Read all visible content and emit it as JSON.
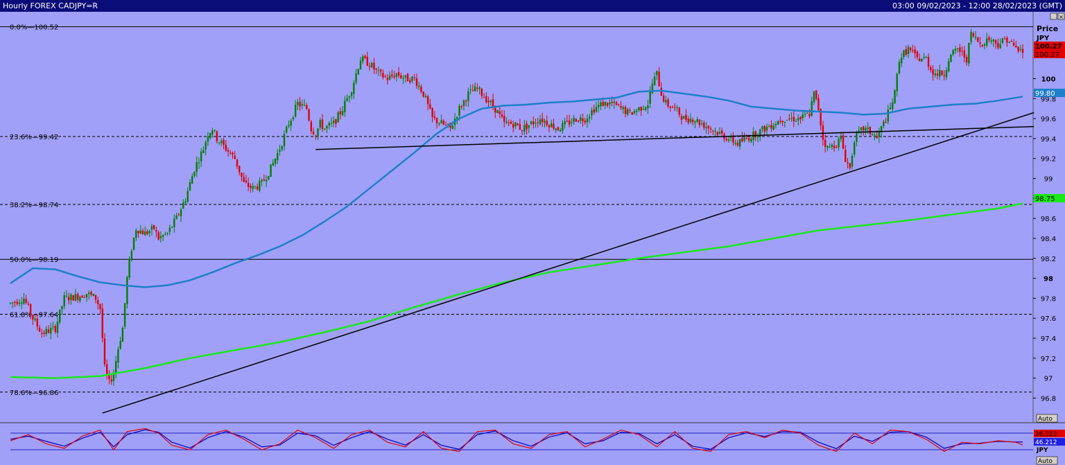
{
  "window": {
    "title": "Hourly FOREX CADJPY=R",
    "range": "03:00 09/02/2023 - 12:00 28/02/2023 (GMT)"
  },
  "axis": {
    "header": "Price",
    "unit": "JPY",
    "auto_label": "Auto",
    "lower_unit": "JPY",
    "lower_auto_label": "Auto"
  },
  "tags": {
    "last_price": "100.27",
    "last_price_2": "100.27",
    "ma_fast": "99.80",
    "ma_slow": "98.75",
    "stoch_k": "36.313",
    "stoch_d": "46.212"
  },
  "colors": {
    "background": "#a0a0f8",
    "up_candle": "#008000",
    "down_candle": "#e00000",
    "ma_fast": "#1f7fc8",
    "ma_slow": "#18e818",
    "trendline": "#000000",
    "stoch_k": "#e00000",
    "stoch_d": "#0000c0"
  },
  "chart_data": {
    "type": "line",
    "ylim": [
      96.56,
      100.67
    ],
    "y_ticks": [
      "100",
      "99.8",
      "99.6",
      "99.4",
      "99.2",
      "99",
      "98.8",
      "98.6",
      "98.4",
      "98.2",
      "98",
      "97.8",
      "97.6",
      "97.4",
      "97.2",
      "97",
      "96.8"
    ],
    "fib_levels": [
      {
        "label": "0.0%",
        "price_label": "100.52",
        "value": 100.52,
        "style": "solid"
      },
      {
        "label": "23.6%",
        "price_label": "99.42",
        "value": 99.42,
        "style": "dashed"
      },
      {
        "label": "38.2%",
        "price_label": "98.74",
        "value": 98.74,
        "style": "dashed"
      },
      {
        "label": "50.0%",
        "price_label": "98.19",
        "value": 98.19,
        "style": "solid"
      },
      {
        "label": "61.8%",
        "price_label": "97.64",
        "value": 97.64,
        "style": "dashed"
      },
      {
        "label": "78.6%",
        "price_label": "96.86",
        "value": 96.86,
        "style": "dashed"
      }
    ],
    "x_range": [
      0,
      455
    ],
    "price_path": [
      [
        0,
        97.75
      ],
      [
        6,
        97.8
      ],
      [
        10,
        97.6
      ],
      [
        14,
        97.45
      ],
      [
        20,
        97.5
      ],
      [
        24,
        97.8
      ],
      [
        30,
        97.82
      ],
      [
        34,
        97.85
      ],
      [
        38,
        97.8
      ],
      [
        40,
        97.7
      ],
      [
        42,
        97.1
      ],
      [
        44,
        96.95
      ],
      [
        46,
        97.05
      ],
      [
        48,
        97.3
      ],
      [
        50,
        97.5
      ],
      [
        52,
        98.0
      ],
      [
        54,
        98.3
      ],
      [
        56,
        98.5
      ],
      [
        60,
        98.45
      ],
      [
        64,
        98.5
      ],
      [
        66,
        98.4
      ],
      [
        70,
        98.45
      ],
      [
        74,
        98.6
      ],
      [
        78,
        98.8
      ],
      [
        82,
        99.1
      ],
      [
        86,
        99.3
      ],
      [
        88,
        99.45
      ],
      [
        90,
        99.5
      ],
      [
        92,
        99.4
      ],
      [
        96,
        99.3
      ],
      [
        100,
        99.2
      ],
      [
        104,
        98.95
      ],
      [
        108,
        98.9
      ],
      [
        112,
        98.95
      ],
      [
        116,
        99.1
      ],
      [
        120,
        99.3
      ],
      [
        124,
        99.55
      ],
      [
        128,
        99.75
      ],
      [
        132,
        99.7
      ],
      [
        134,
        99.5
      ],
      [
        136,
        99.45
      ],
      [
        138,
        99.55
      ],
      [
        140,
        99.5
      ],
      [
        144,
        99.55
      ],
      [
        148,
        99.7
      ],
      [
        152,
        99.9
      ],
      [
        156,
        100.2
      ],
      [
        160,
        100.15
      ],
      [
        164,
        100.05
      ],
      [
        168,
        100.0
      ],
      [
        172,
        100.05
      ],
      [
        176,
        100.0
      ],
      [
        180,
        100.0
      ],
      [
        184,
        99.85
      ],
      [
        188,
        99.6
      ],
      [
        192,
        99.55
      ],
      [
        196,
        99.5
      ],
      [
        200,
        99.7
      ],
      [
        204,
        99.85
      ],
      [
        208,
        99.9
      ],
      [
        212,
        99.8
      ],
      [
        216,
        99.7
      ],
      [
        220,
        99.55
      ],
      [
        224,
        99.55
      ],
      [
        228,
        99.5
      ],
      [
        232,
        99.55
      ],
      [
        236,
        99.6
      ],
      [
        240,
        99.55
      ],
      [
        244,
        99.5
      ],
      [
        248,
        99.55
      ],
      [
        252,
        99.6
      ],
      [
        256,
        99.6
      ],
      [
        260,
        99.7
      ],
      [
        264,
        99.75
      ],
      [
        268,
        99.75
      ],
      [
        272,
        99.7
      ],
      [
        276,
        99.65
      ],
      [
        280,
        99.7
      ],
      [
        284,
        99.75
      ],
      [
        286,
        99.95
      ],
      [
        288,
        100.05
      ],
      [
        290,
        99.85
      ],
      [
        292,
        99.75
      ],
      [
        296,
        99.7
      ],
      [
        300,
        99.6
      ],
      [
        304,
        99.6
      ],
      [
        308,
        99.55
      ],
      [
        312,
        99.5
      ],
      [
        316,
        99.45
      ],
      [
        320,
        99.4
      ],
      [
        324,
        99.35
      ],
      [
        328,
        99.4
      ],
      [
        332,
        99.45
      ],
      [
        336,
        99.5
      ],
      [
        340,
        99.55
      ],
      [
        344,
        99.6
      ],
      [
        348,
        99.6
      ],
      [
        352,
        99.6
      ],
      [
        356,
        99.65
      ],
      [
        358,
        99.85
      ],
      [
        360,
        99.7
      ],
      [
        362,
        99.4
      ],
      [
        364,
        99.3
      ],
      [
        368,
        99.35
      ],
      [
        370,
        99.4
      ],
      [
        372,
        99.2
      ],
      [
        374,
        99.1
      ],
      [
        376,
        99.4
      ],
      [
        380,
        99.5
      ],
      [
        384,
        99.45
      ],
      [
        386,
        99.4
      ],
      [
        388,
        99.5
      ],
      [
        392,
        99.7
      ],
      [
        394,
        99.85
      ],
      [
        396,
        100.2
      ],
      [
        400,
        100.3
      ],
      [
        404,
        100.2
      ],
      [
        408,
        100.2
      ],
      [
        410,
        100.1
      ],
      [
        412,
        100.05
      ],
      [
        416,
        100.05
      ],
      [
        418,
        100.2
      ],
      [
        422,
        100.3
      ],
      [
        426,
        100.2
      ],
      [
        428,
        100.45
      ],
      [
        432,
        100.35
      ],
      [
        436,
        100.4
      ],
      [
        440,
        100.35
      ],
      [
        444,
        100.4
      ],
      [
        448,
        100.3
      ],
      [
        451,
        100.27
      ]
    ],
    "series": [
      {
        "name": "",
        "kind": "ma_fast",
        "points": [
          [
            0,
            97.95
          ],
          [
            10,
            98.1
          ],
          [
            20,
            98.09
          ],
          [
            30,
            98.02
          ],
          [
            40,
            97.96
          ],
          [
            50,
            97.93
          ],
          [
            60,
            97.91
          ],
          [
            70,
            97.93
          ],
          [
            80,
            97.98
          ],
          [
            90,
            98.06
          ],
          [
            100,
            98.15
          ],
          [
            110,
            98.23
          ],
          [
            120,
            98.32
          ],
          [
            130,
            98.43
          ],
          [
            140,
            98.57
          ],
          [
            150,
            98.72
          ],
          [
            160,
            98.9
          ],
          [
            170,
            99.08
          ],
          [
            180,
            99.26
          ],
          [
            190,
            99.45
          ],
          [
            200,
            99.6
          ],
          [
            210,
            99.7
          ],
          [
            220,
            99.73
          ],
          [
            230,
            99.74
          ],
          [
            240,
            99.76
          ],
          [
            250,
            99.77
          ],
          [
            260,
            99.79
          ],
          [
            270,
            99.81
          ],
          [
            280,
            99.87
          ],
          [
            290,
            99.88
          ],
          [
            300,
            99.85
          ],
          [
            310,
            99.82
          ],
          [
            320,
            99.78
          ],
          [
            330,
            99.72
          ],
          [
            340,
            99.7
          ],
          [
            350,
            99.68
          ],
          [
            360,
            99.67
          ],
          [
            370,
            99.66
          ],
          [
            380,
            99.64
          ],
          [
            390,
            99.65
          ],
          [
            400,
            99.7
          ],
          [
            410,
            99.72
          ],
          [
            420,
            99.74
          ],
          [
            430,
            99.75
          ],
          [
            440,
            99.78
          ],
          [
            451,
            99.82
          ]
        ]
      },
      {
        "name": "",
        "kind": "ma_slow",
        "points": [
          [
            0,
            97.01
          ],
          [
            20,
            97.0
          ],
          [
            40,
            97.02
          ],
          [
            60,
            97.1
          ],
          [
            80,
            97.2
          ],
          [
            100,
            97.28
          ],
          [
            120,
            97.36
          ],
          [
            140,
            97.46
          ],
          [
            160,
            97.57
          ],
          [
            180,
            97.71
          ],
          [
            200,
            97.84
          ],
          [
            220,
            97.96
          ],
          [
            240,
            98.06
          ],
          [
            260,
            98.13
          ],
          [
            280,
            98.2
          ],
          [
            300,
            98.26
          ],
          [
            320,
            98.32
          ],
          [
            340,
            98.4
          ],
          [
            360,
            98.48
          ],
          [
            380,
            98.53
          ],
          [
            400,
            98.58
          ],
          [
            420,
            98.64
          ],
          [
            440,
            98.7
          ],
          [
            451,
            98.75
          ]
        ]
      },
      {
        "name": "",
        "kind": "trendline_rising",
        "points": [
          [
            41,
            96.65
          ],
          [
            456,
            99.66
          ]
        ]
      },
      {
        "name": "",
        "kind": "trendline_flat",
        "points": [
          [
            136,
            99.29
          ],
          [
            456,
            99.52
          ]
        ]
      }
    ],
    "stochastic": {
      "ylim": [
        0,
        100
      ],
      "upper_band": 80,
      "lower_band": 20,
      "k": [
        [
          0,
          50
        ],
        [
          8,
          70
        ],
        [
          16,
          40
        ],
        [
          24,
          25
        ],
        [
          32,
          65
        ],
        [
          40,
          85
        ],
        [
          46,
          20
        ],
        [
          52,
          80
        ],
        [
          60,
          90
        ],
        [
          66,
          75
        ],
        [
          72,
          35
        ],
        [
          80,
          20
        ],
        [
          88,
          70
        ],
        [
          96,
          85
        ],
        [
          104,
          55
        ],
        [
          112,
          20
        ],
        [
          120,
          40
        ],
        [
          128,
          85
        ],
        [
          136,
          60
        ],
        [
          144,
          25
        ],
        [
          152,
          70
        ],
        [
          160,
          85
        ],
        [
          168,
          45
        ],
        [
          176,
          30
        ],
        [
          184,
          80
        ],
        [
          192,
          25
        ],
        [
          200,
          15
        ],
        [
          208,
          80
        ],
        [
          216,
          85
        ],
        [
          224,
          40
        ],
        [
          232,
          25
        ],
        [
          240,
          70
        ],
        [
          248,
          80
        ],
        [
          256,
          30
        ],
        [
          264,
          55
        ],
        [
          272,
          85
        ],
        [
          280,
          70
        ],
        [
          288,
          30
        ],
        [
          296,
          80
        ],
        [
          304,
          25
        ],
        [
          312,
          15
        ],
        [
          320,
          70
        ],
        [
          328,
          80
        ],
        [
          336,
          60
        ],
        [
          344,
          85
        ],
        [
          352,
          75
        ],
        [
          360,
          35
        ],
        [
          368,
          15
        ],
        [
          376,
          75
        ],
        [
          384,
          40
        ],
        [
          392,
          85
        ],
        [
          400,
          80
        ],
        [
          408,
          55
        ],
        [
          416,
          15
        ],
        [
          424,
          45
        ],
        [
          432,
          40
        ],
        [
          440,
          50
        ],
        [
          448,
          45
        ],
        [
          451,
          36
        ]
      ],
      "d": [
        [
          0,
          55
        ],
        [
          8,
          65
        ],
        [
          16,
          48
        ],
        [
          24,
          32
        ],
        [
          32,
          58
        ],
        [
          40,
          78
        ],
        [
          46,
          30
        ],
        [
          52,
          70
        ],
        [
          60,
          86
        ],
        [
          66,
          78
        ],
        [
          72,
          45
        ],
        [
          80,
          26
        ],
        [
          88,
          60
        ],
        [
          96,
          80
        ],
        [
          104,
          62
        ],
        [
          112,
          30
        ],
        [
          120,
          36
        ],
        [
          128,
          75
        ],
        [
          136,
          66
        ],
        [
          144,
          35
        ],
        [
          152,
          60
        ],
        [
          160,
          80
        ],
        [
          168,
          55
        ],
        [
          176,
          36
        ],
        [
          184,
          70
        ],
        [
          192,
          35
        ],
        [
          200,
          22
        ],
        [
          208,
          70
        ],
        [
          216,
          82
        ],
        [
          224,
          50
        ],
        [
          232,
          32
        ],
        [
          240,
          62
        ],
        [
          248,
          76
        ],
        [
          256,
          40
        ],
        [
          264,
          50
        ],
        [
          272,
          78
        ],
        [
          280,
          74
        ],
        [
          288,
          40
        ],
        [
          296,
          70
        ],
        [
          304,
          32
        ],
        [
          312,
          22
        ],
        [
          320,
          60
        ],
        [
          328,
          76
        ],
        [
          336,
          64
        ],
        [
          344,
          80
        ],
        [
          352,
          78
        ],
        [
          360,
          45
        ],
        [
          368,
          24
        ],
        [
          376,
          65
        ],
        [
          384,
          48
        ],
        [
          392,
          78
        ],
        [
          400,
          80
        ],
        [
          408,
          62
        ],
        [
          416,
          25
        ],
        [
          424,
          40
        ],
        [
          432,
          42
        ],
        [
          440,
          48
        ],
        [
          448,
          46
        ],
        [
          451,
          46
        ]
      ]
    }
  }
}
